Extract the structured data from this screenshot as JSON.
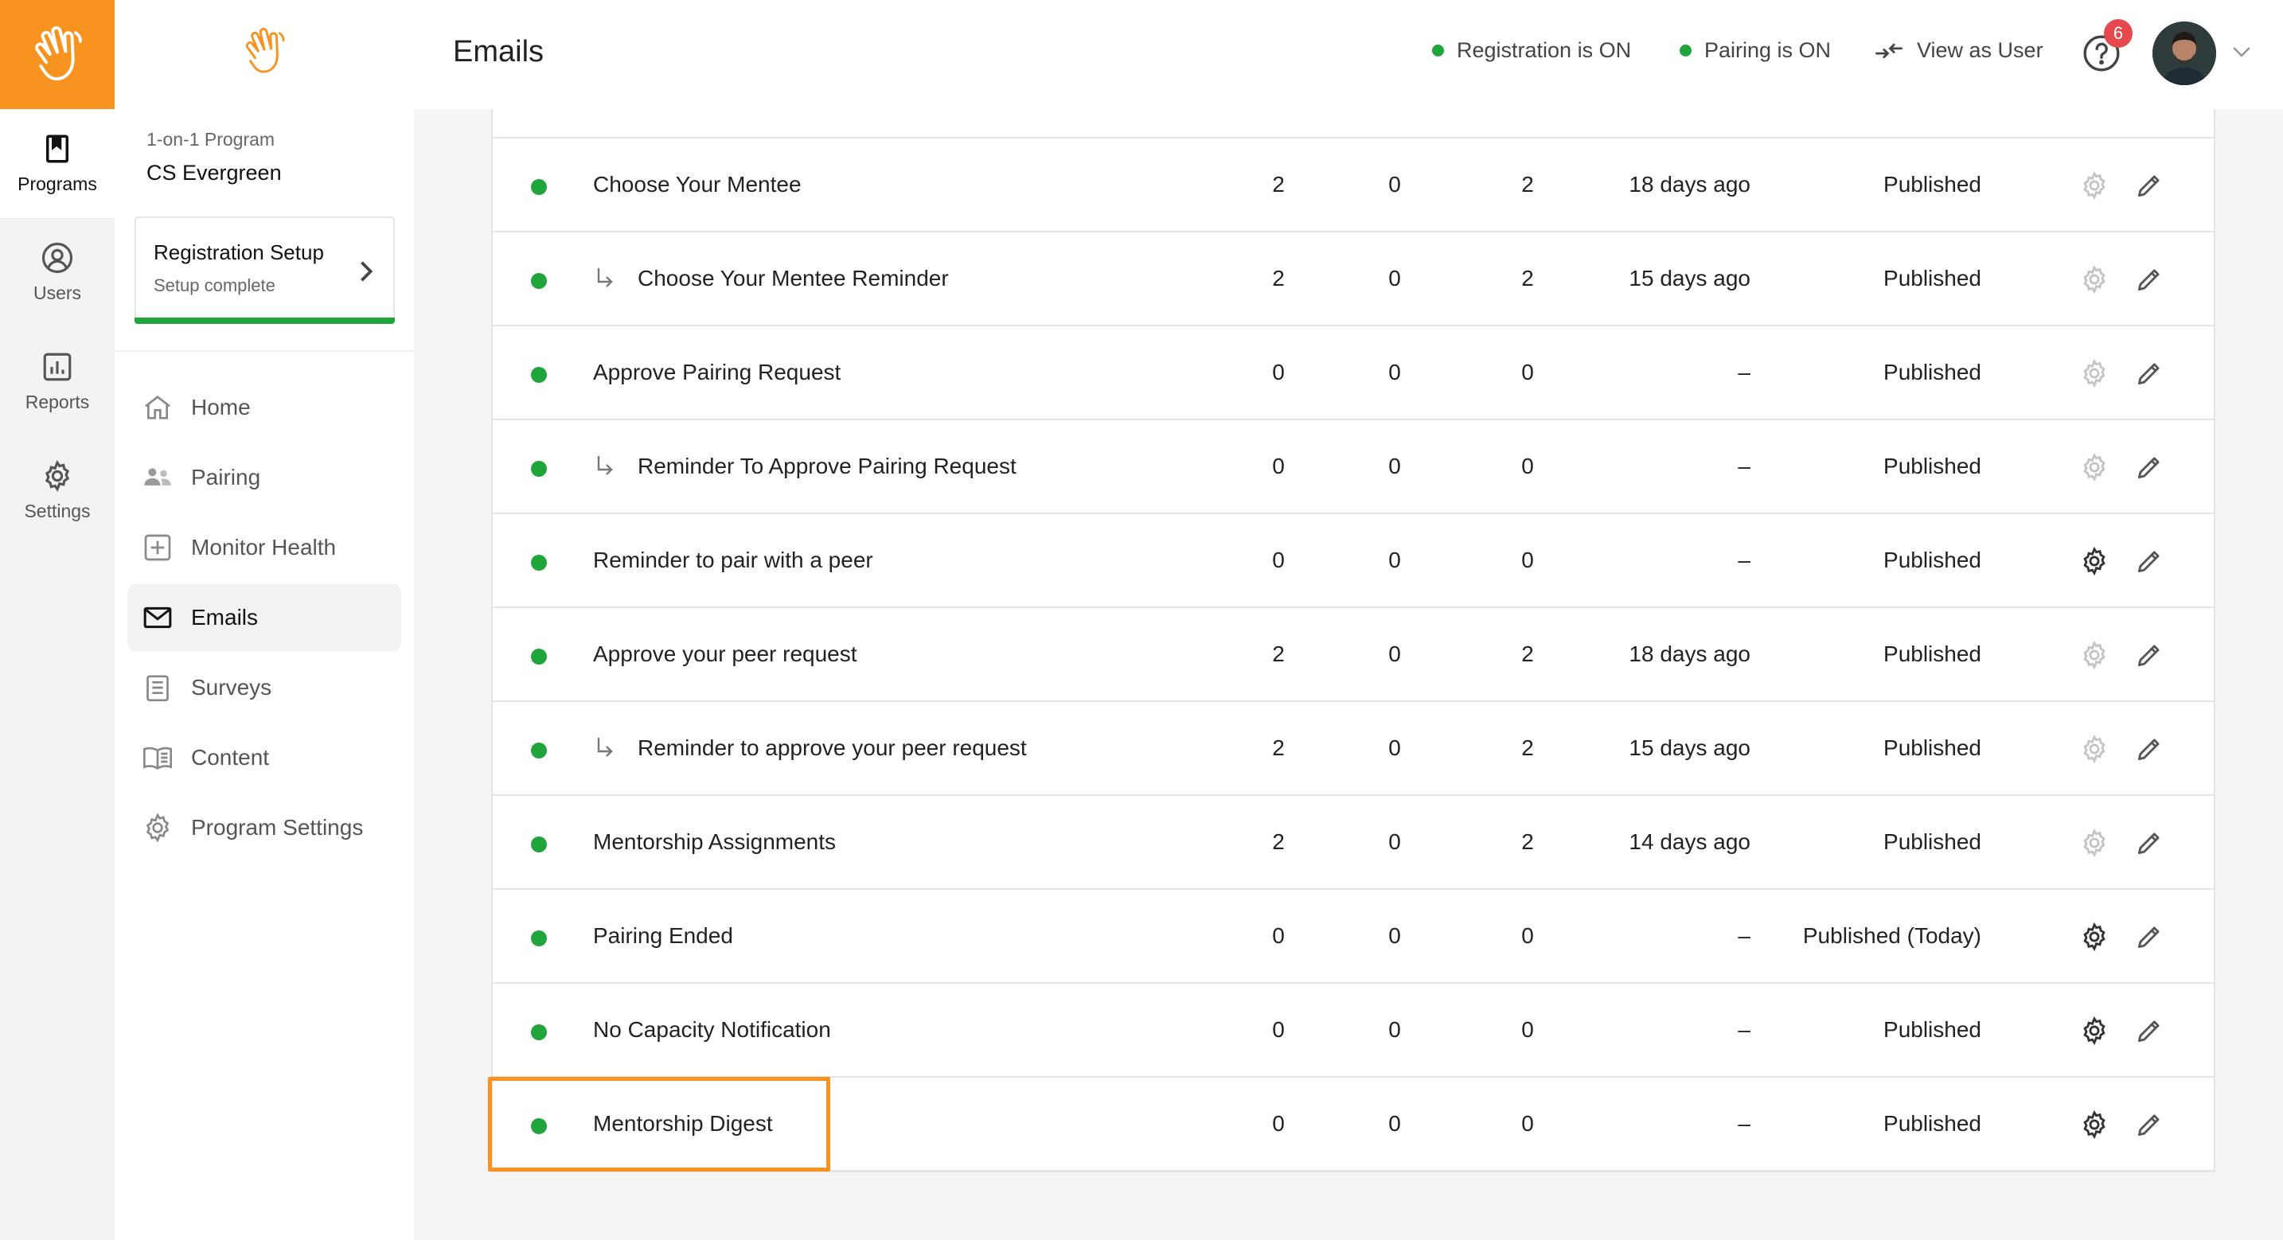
{
  "rail": {
    "items": [
      {
        "label": "Programs",
        "icon": "bookmark-icon",
        "active": true
      },
      {
        "label": "Users",
        "icon": "user-circle-icon"
      },
      {
        "label": "Reports",
        "icon": "bar-chart-icon"
      },
      {
        "label": "Settings",
        "icon": "gear-icon"
      }
    ]
  },
  "program": {
    "type": "1-on-1 Program",
    "name": "CS Evergreen",
    "registration_title": "Registration Setup",
    "registration_status": "Setup complete"
  },
  "nav": [
    {
      "label": "Home",
      "icon": "home-icon"
    },
    {
      "label": "Pairing",
      "icon": "pairing-icon"
    },
    {
      "label": "Monitor Health",
      "icon": "health-plus-icon"
    },
    {
      "label": "Emails",
      "icon": "mail-icon",
      "active": true
    },
    {
      "label": "Surveys",
      "icon": "clipboard-icon"
    },
    {
      "label": "Content",
      "icon": "book-open-icon"
    },
    {
      "label": "Program Settings",
      "icon": "gear-icon"
    }
  ],
  "header": {
    "title": "Emails",
    "registration": "Registration is ON",
    "pairing": "Pairing is ON",
    "view_as_user": "View as User",
    "notifications": "6"
  },
  "emails": [
    {
      "name": "Choose Your Mentee",
      "sub": false,
      "c1": "2",
      "c2": "0",
      "c3": "2",
      "when": "18 days ago",
      "status": "Published",
      "gear_dark": false
    },
    {
      "name": "Choose Your Mentee Reminder",
      "sub": true,
      "c1": "2",
      "c2": "0",
      "c3": "2",
      "when": "15 days ago",
      "status": "Published",
      "gear_dark": false
    },
    {
      "name": "Approve Pairing Request",
      "sub": false,
      "c1": "0",
      "c2": "0",
      "c3": "0",
      "when": "–",
      "status": "Published",
      "gear_dark": false
    },
    {
      "name": "Reminder To Approve Pairing Request",
      "sub": true,
      "c1": "0",
      "c2": "0",
      "c3": "0",
      "when": "–",
      "status": "Published",
      "gear_dark": false
    },
    {
      "name": "Reminder to pair with a peer",
      "sub": false,
      "c1": "0",
      "c2": "0",
      "c3": "0",
      "when": "–",
      "status": "Published",
      "gear_dark": true
    },
    {
      "name": "Approve your peer request",
      "sub": false,
      "c1": "2",
      "c2": "0",
      "c3": "2",
      "when": "18 days ago",
      "status": "Published",
      "gear_dark": false
    },
    {
      "name": "Reminder to approve your peer request",
      "sub": true,
      "c1": "2",
      "c2": "0",
      "c3": "2",
      "when": "15 days ago",
      "status": "Published",
      "gear_dark": false
    },
    {
      "name": "Mentorship Assignments",
      "sub": false,
      "c1": "2",
      "c2": "0",
      "c3": "2",
      "when": "14 days ago",
      "status": "Published",
      "gear_dark": false
    },
    {
      "name": "Pairing Ended",
      "sub": false,
      "c1": "0",
      "c2": "0",
      "c3": "0",
      "when": "–",
      "status": "Published (Today)",
      "gear_dark": true
    },
    {
      "name": "No Capacity Notification",
      "sub": false,
      "c1": "0",
      "c2": "0",
      "c3": "0",
      "when": "–",
      "status": "Published",
      "gear_dark": true
    },
    {
      "name": "Mentorship Digest",
      "sub": false,
      "c1": "0",
      "c2": "0",
      "c3": "0",
      "when": "–",
      "status": "Published",
      "gear_dark": true
    }
  ],
  "colors": {
    "brand": "#f7931e",
    "active_dot": "#1fa53a",
    "badge": "#e5484d"
  }
}
